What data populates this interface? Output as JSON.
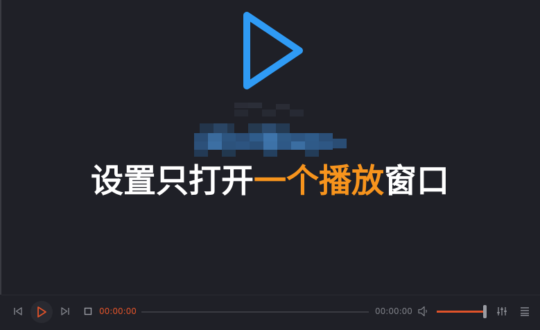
{
  "caption": {
    "part1": "设置只打开",
    "part2": "一个",
    "part3": "播放",
    "part4": "窗口"
  },
  "controls": {
    "current_time": "00:00:00",
    "total_time": "00:00:00",
    "volume_level": 1.0
  },
  "icons": {
    "big_play": "play-icon",
    "prev": "skip-previous-icon",
    "play": "play-icon",
    "next": "skip-next-icon",
    "stop": "stop-icon",
    "volume": "volume-icon",
    "equalizer": "equalizer-icon",
    "playlist": "playlist-menu-icon"
  },
  "colors": {
    "background": "#1f2027",
    "accent": "#e0532a",
    "highlight": "#f7941d",
    "play_blue": "#2f9bf5",
    "text_dim": "#7d7f86"
  }
}
